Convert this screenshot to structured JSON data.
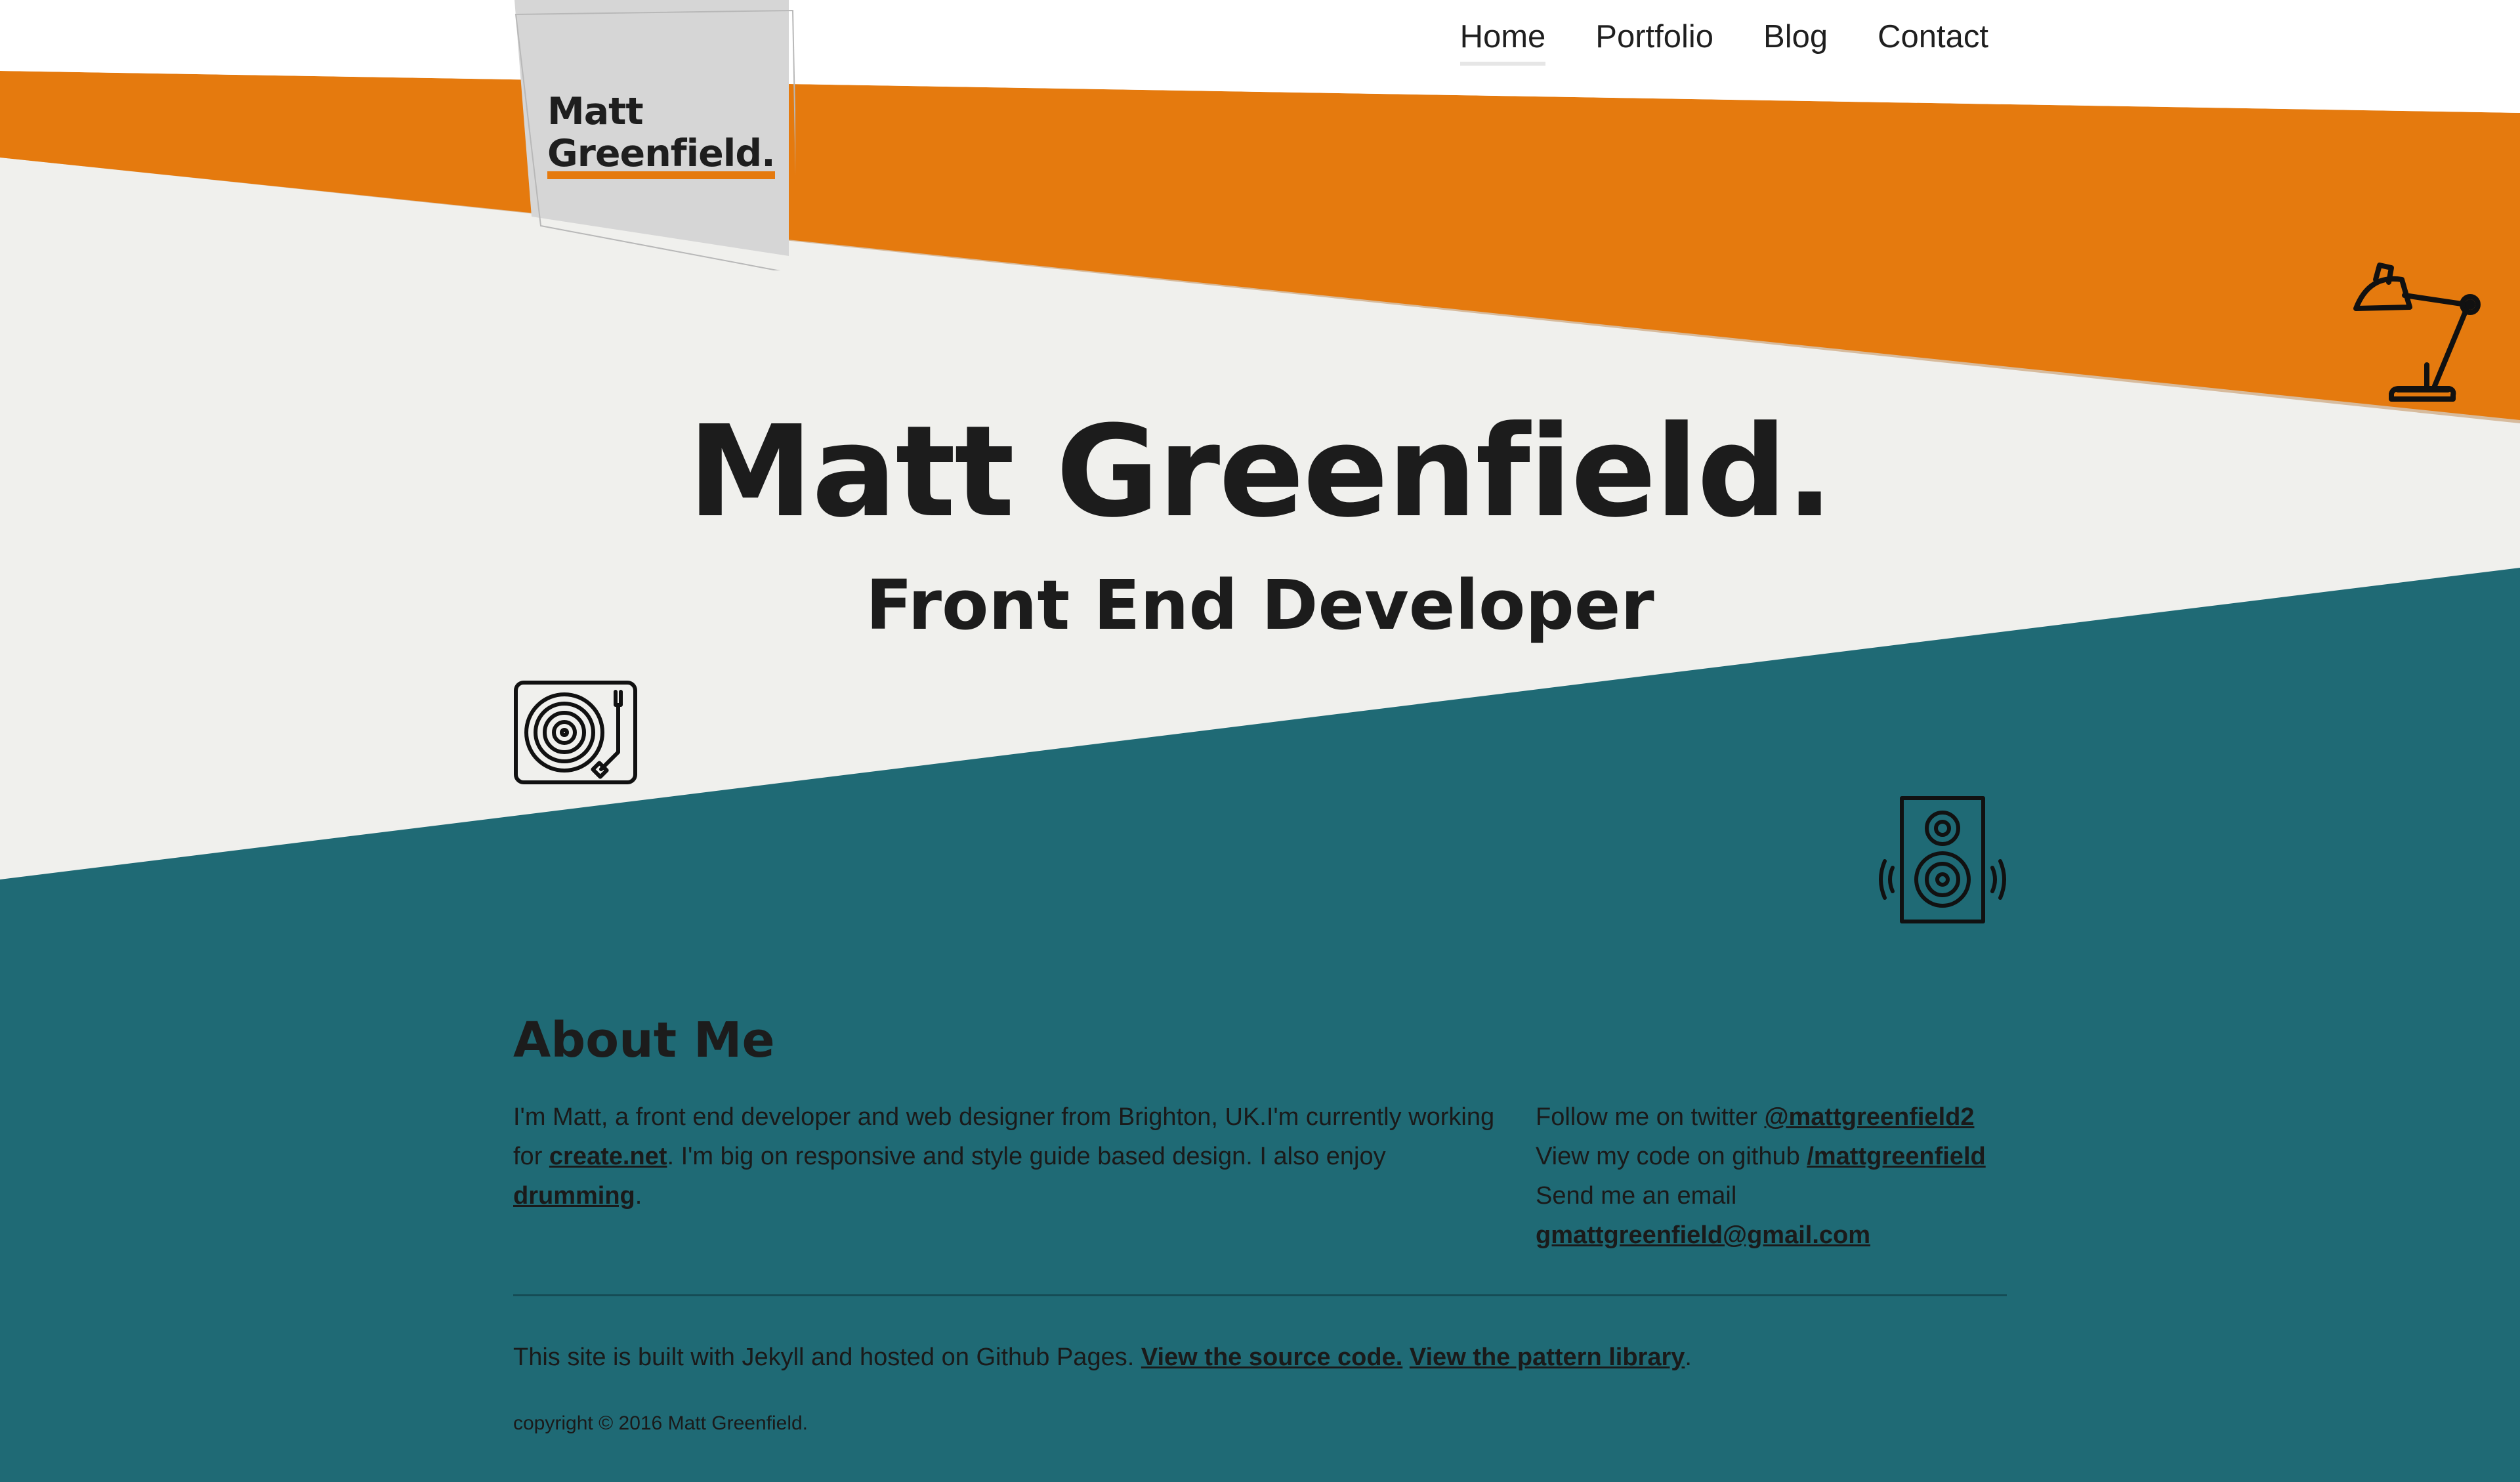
{
  "nav": {
    "home": "Home",
    "portfolio": "Portfolio",
    "blog": "Blog",
    "contact": "Contact"
  },
  "logo": {
    "line1": "Matt",
    "line2": "Greenfield."
  },
  "hero": {
    "title": "Matt Greenfield.",
    "subtitle": "Front End Developer"
  },
  "about": {
    "heading": "About Me",
    "intro_before_link": "I'm Matt, a front end developer and web designer from Brighton, UK.I'm currently working for ",
    "work_link": "create.net",
    "intro_middle": ". I'm big on responsive and style guide based design. I also enjoy ",
    "drumming_link": "drumming",
    "intro_end": ".",
    "twitter_prefix": "Follow me on twitter ",
    "twitter_handle": "@mattgreenfield2",
    "github_prefix": "View my code on github ",
    "github_handle": "/mattgreenfield",
    "email_prefix": "Send me an email",
    "email": "gmattgreenfield@gmail.com"
  },
  "footer": {
    "built_text": "This site is built with Jekyll and hosted on Github Pages. ",
    "source_link": "View the source code.",
    "pattern_link": "View the pattern library",
    "built_end": ".",
    "copyright": "copyright © 2016 Matt Greenfield."
  },
  "icons": {
    "lamp": "desk-lamp-icon",
    "turntable": "turntable-icon",
    "speaker": "speaker-icon"
  },
  "colors": {
    "orange": "#e57a0e",
    "teal": "#1f6a75",
    "light": "#f0f0ed",
    "text": "#1c1c1c"
  }
}
